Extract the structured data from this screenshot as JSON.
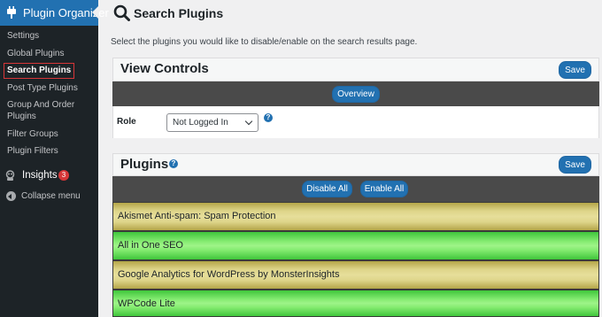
{
  "sidebar": {
    "menu_title": "Plugin Organizer",
    "items": [
      {
        "label": "Settings"
      },
      {
        "label": "Global Plugins"
      },
      {
        "label": "Search Plugins"
      },
      {
        "label": "Post Type Plugins"
      },
      {
        "label": "Group And Order Plugins"
      },
      {
        "label": "Filter Groups"
      },
      {
        "label": "Plugin Filters"
      }
    ],
    "insights_label": "Insights",
    "insights_badge": "3",
    "collapse_label": "Collapse menu"
  },
  "page": {
    "title": "Search Plugins",
    "description": "Select the plugins you would like to disable/enable on the search results page."
  },
  "view_controls": {
    "title": "View Controls",
    "save_label": "Save",
    "overview_label": "Overview",
    "role_label": "Role",
    "role_value": "Not Logged In"
  },
  "plugins": {
    "title": "Plugins",
    "save_label": "Save",
    "disable_all_label": "Disable All",
    "enable_all_label": "Enable All",
    "rows": [
      {
        "name": "Akismet Anti-spam: Spam Protection",
        "state": "disabled"
      },
      {
        "name": "All in One SEO",
        "state": "enabled"
      },
      {
        "name": "Google Analytics for WordPress by MonsterInsights",
        "state": "disabled"
      },
      {
        "name": "WPCode Lite",
        "state": "enabled"
      }
    ]
  },
  "colors": {
    "accent": "#2271b1",
    "sidebar_bg": "#1d2327",
    "disabled_row": "#e6de9a",
    "enabled_row": "#9ef488"
  },
  "icons": {
    "menu": "plugin-icon",
    "title": "search-icon",
    "insights": "insights-icon",
    "help": "help-icon",
    "collapse": "collapse-arrow-icon"
  }
}
